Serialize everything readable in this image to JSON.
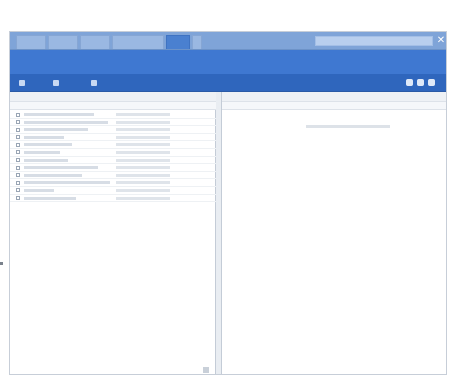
{
  "window": {
    "title": ""
  },
  "tabs": [
    {
      "label": "",
      "active": false
    },
    {
      "label": "",
      "active": false
    },
    {
      "label": "",
      "active": false
    },
    {
      "label": "",
      "active": false
    },
    {
      "label": "",
      "active": true
    },
    {
      "label": "",
      "active": false
    }
  ],
  "search": {
    "placeholder": ""
  },
  "header": {
    "heading": ""
  },
  "toolbar": {
    "buttons": [
      {
        "label": "",
        "icon": "add-icon"
      },
      {
        "label": "",
        "icon": "folder-icon"
      },
      {
        "label": "",
        "icon": "tag-icon"
      }
    ],
    "right_icons": [
      "grid-icon",
      "list-icon",
      "settings-icon"
    ]
  },
  "left_pane": {
    "title": "",
    "columns": {
      "name": "",
      "date": ""
    },
    "rows": [
      {
        "name": "",
        "date": ""
      },
      {
        "name": "",
        "date": ""
      },
      {
        "name": "",
        "date": ""
      },
      {
        "name": "",
        "date": ""
      },
      {
        "name": "",
        "date": ""
      },
      {
        "name": "",
        "date": ""
      },
      {
        "name": "",
        "date": ""
      },
      {
        "name": "",
        "date": ""
      },
      {
        "name": "",
        "date": ""
      },
      {
        "name": "",
        "date": ""
      },
      {
        "name": "",
        "date": ""
      },
      {
        "name": "",
        "date": ""
      }
    ]
  },
  "right_pane": {
    "title": "",
    "columns": {
      "name": "",
      "info": ""
    },
    "empty_message": ""
  },
  "colors": {
    "tabbar": "#7fa4d8",
    "header": "#3f78d1",
    "toolbar": "#2f66bd",
    "pane_background": "#ffffff"
  }
}
